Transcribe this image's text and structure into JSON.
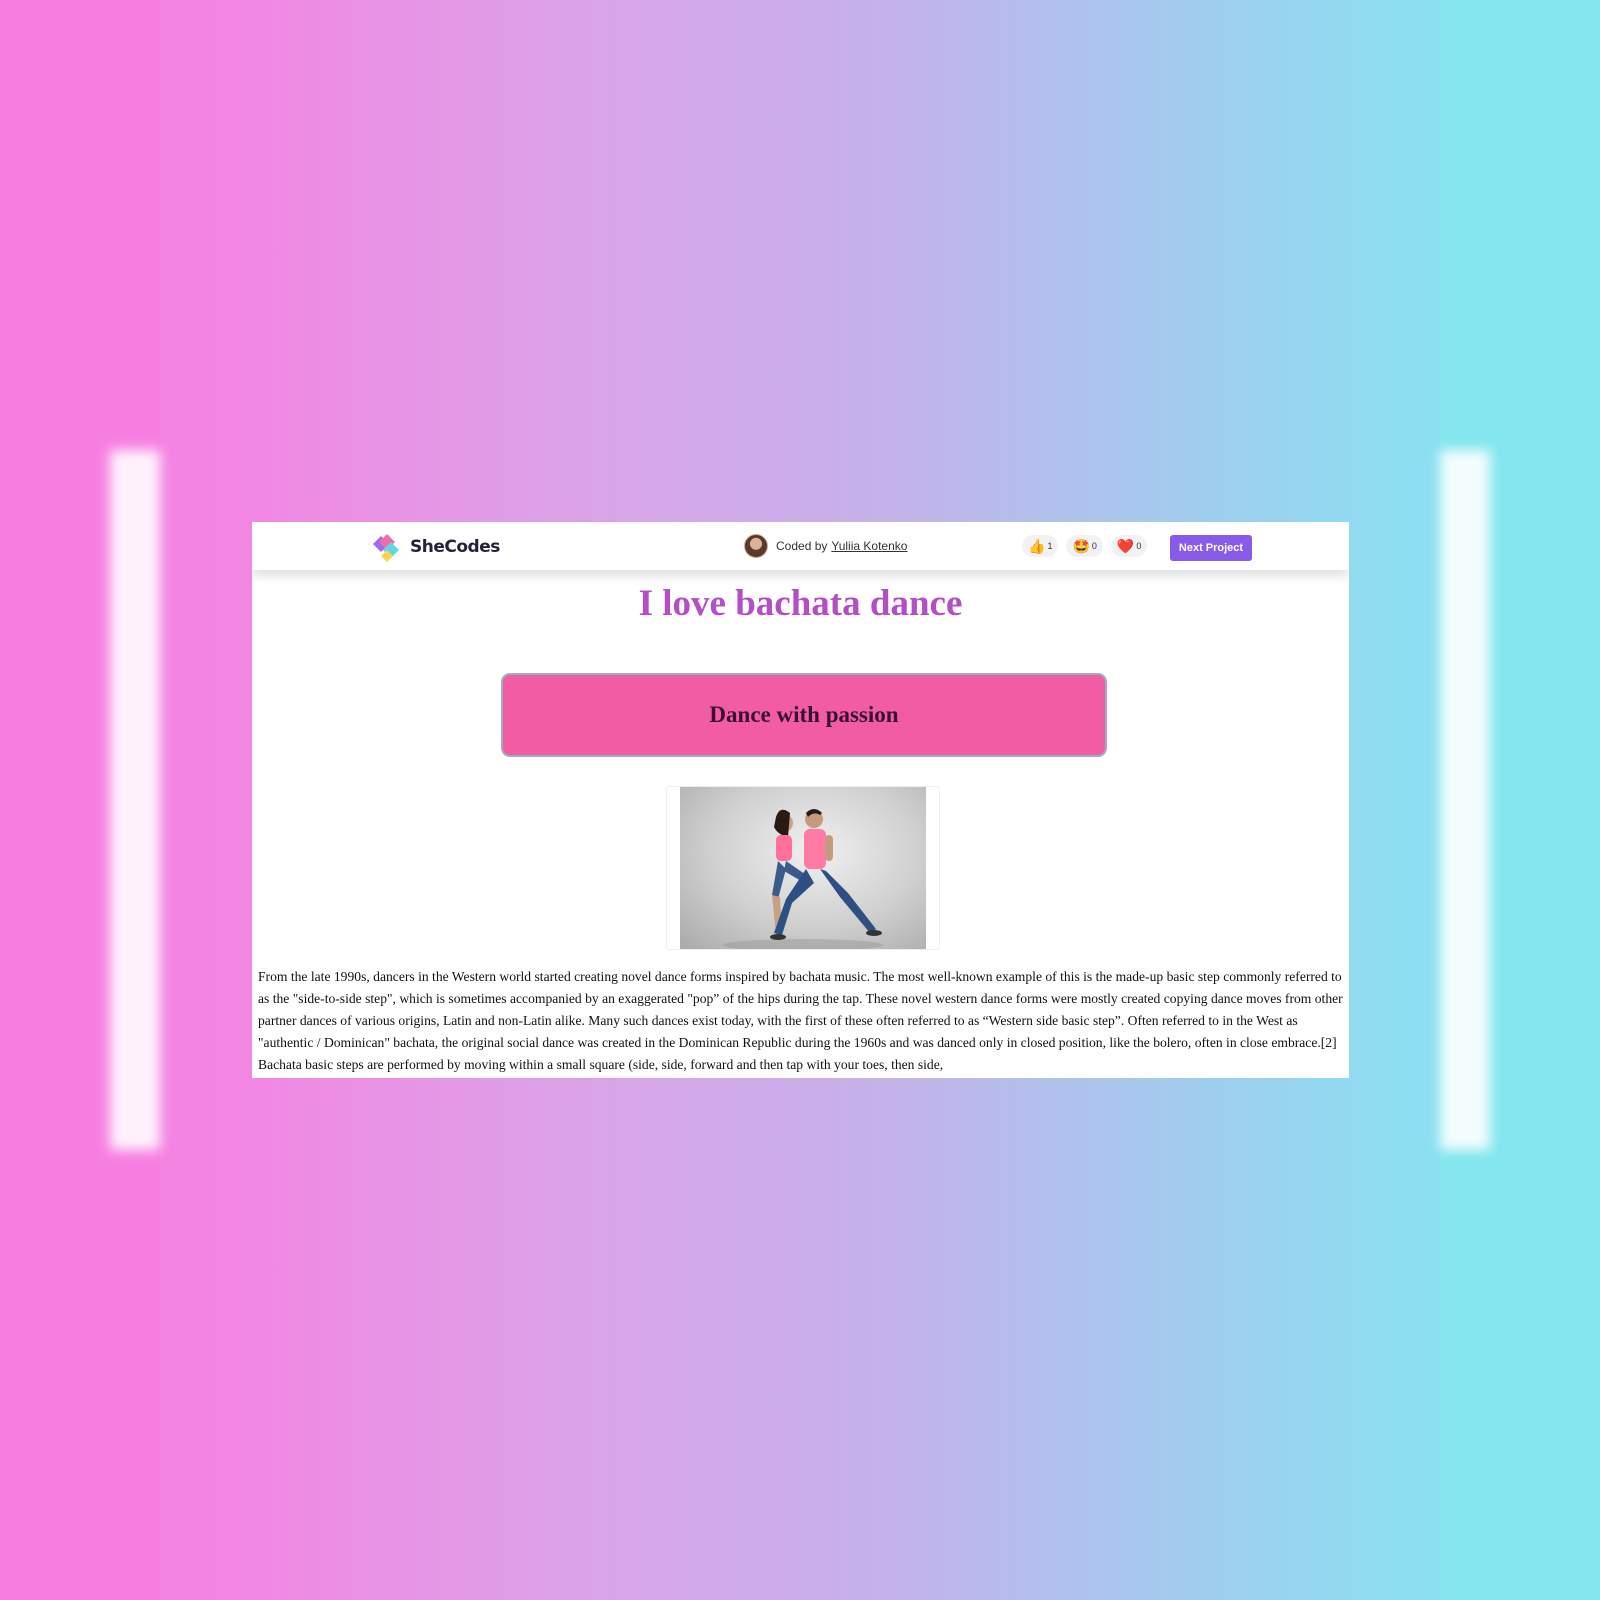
{
  "header": {
    "logo_text": "SheCodes",
    "coded_by_label": "Coded by",
    "author_name": "Yuliia Kotenko",
    "reactions": [
      {
        "icon": "thumbs-up-icon",
        "glyph": "👍",
        "count": "1"
      },
      {
        "icon": "star-struck-icon",
        "glyph": "🤩",
        "count": "0"
      },
      {
        "icon": "heart-icon",
        "glyph": "❤️",
        "count": "0"
      }
    ],
    "next_button": "Next Project"
  },
  "main": {
    "title": "I love bachata dance",
    "banner": "Dance with passion",
    "image": {
      "semantic": "bachata-dancers-photo"
    },
    "paragraph": "From the late 1990s, dancers in the Western world started creating novel dance forms inspired by bachata music. The most well-known example of this is the made-up basic step commonly referred to as the \"side-to-side step\", which is sometimes accompanied by an exaggerated \"pop” of the hips during the tap. These novel western dance forms were mostly created copying dance moves from other partner dances of various origins, Latin and non-Latin alike. Many such dances exist today, with the first of these often referred to as “Western side basic step”. Often referred to in the West as \"authentic / Dominican\" bachata, the original social dance was created in the Dominican Republic during the 1960s and was danced only in closed position, like the bolero, often in close embrace.[2] Bachata basic steps are performed by moving within a small square (side, side, forward and then tap with your toes, then side,"
  },
  "colors": {
    "title": "#b44ec7",
    "banner_bg": "#f25ca5",
    "banner_text": "#3a1130",
    "button": "#8a5ae8",
    "gradient_left": "#f67fe0",
    "gradient_right": "#7ee7ef"
  }
}
